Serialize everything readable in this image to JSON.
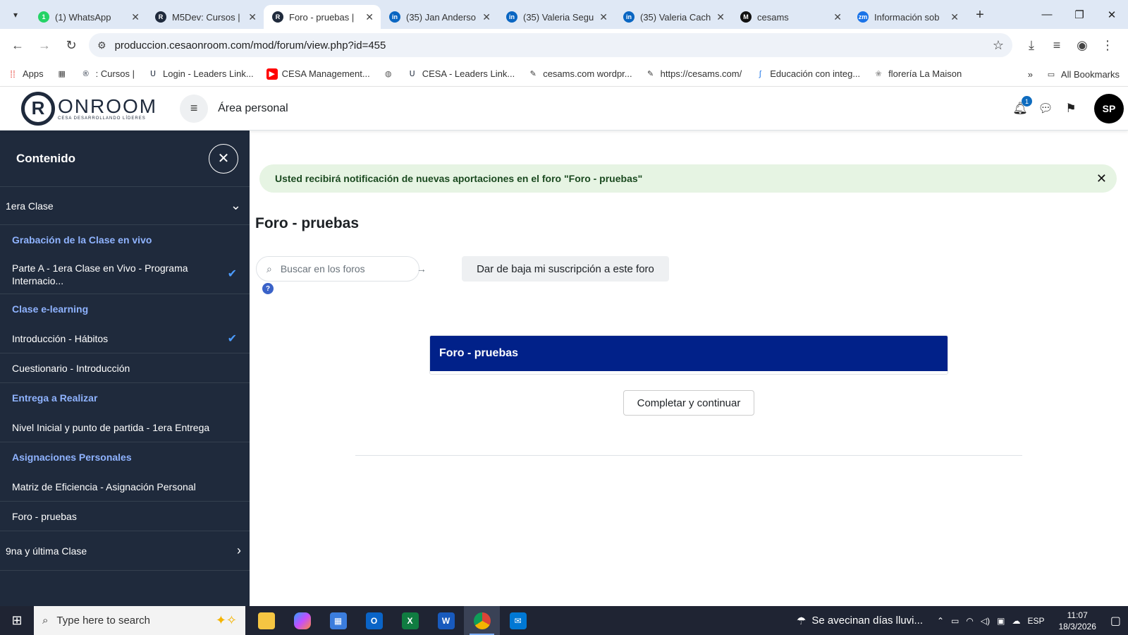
{
  "browser": {
    "tabs": [
      {
        "title": "(1) WhatsApp",
        "icon": "whatsapp-icon",
        "color": "#25d366",
        "glyph": "1"
      },
      {
        "title": "M5Dev: Cursos |",
        "icon": "onroom-icon",
        "color": "#1f2a3c",
        "glyph": "R"
      },
      {
        "title": "Foro - pruebas |",
        "icon": "onroom-icon",
        "color": "#1f2a3c",
        "glyph": "R",
        "active": true
      },
      {
        "title": "(35) Jan Anderso",
        "icon": "linkedin-icon",
        "color": "#0a66c2",
        "glyph": "in"
      },
      {
        "title": "(35) Valeria Segu",
        "icon": "linkedin-icon",
        "color": "#0a66c2",
        "glyph": "in"
      },
      {
        "title": "(35) Valeria Cach",
        "icon": "linkedin-icon",
        "color": "#0a66c2",
        "glyph": "in"
      },
      {
        "title": "cesams",
        "icon": "cesams-icon",
        "color": "#111111",
        "glyph": "M"
      },
      {
        "title": "Información sob",
        "icon": "zm-icon",
        "color": "#1a73e8",
        "glyph": "zm"
      }
    ],
    "url": "produccion.cesaonroom.com/mod/forum/view.php?id=455",
    "bookmarks": [
      {
        "label": "Apps",
        "icon": "apps-grid-icon"
      },
      {
        "label": "",
        "icon": "grid-icon"
      },
      {
        "label": ": Cursos |",
        "icon": "onroom-icon"
      },
      {
        "label": "Login - Leaders Link...",
        "icon": "leaders-link-icon"
      },
      {
        "label": "CESA Management...",
        "icon": "youtube-icon"
      },
      {
        "label": "",
        "icon": "globe-icon"
      },
      {
        "label": "CESA - Leaders Link...",
        "icon": "leaders-link-icon"
      },
      {
        "label": "cesams.com wordpr...",
        "icon": "wordpress-icon"
      },
      {
        "label": "https://cesams.com/",
        "icon": "wordpress-icon"
      },
      {
        "label": "Educación con integ...",
        "icon": "bookmark-icon"
      },
      {
        "label": "florería La Maison",
        "icon": "flower-icon"
      }
    ],
    "all_bookmarks": "All Bookmarks"
  },
  "header": {
    "logo_text": "ONROOM",
    "logo_sub": "CESA DESARROLLANDO LÍDERES",
    "area": "Área personal",
    "notif_count": "1",
    "avatar": "SP"
  },
  "drawer": {
    "title": "Contenido",
    "section1": "1era Clase",
    "items": [
      {
        "label": "Grabación de la Clase en vivo",
        "kind": "head"
      },
      {
        "label": "Parte A - 1era Clase en Vivo - Programa Internacio...",
        "kind": "tall",
        "done": true
      },
      {
        "label": "Clase e-learning",
        "kind": "head"
      },
      {
        "label": "Introducción - Hábitos",
        "kind": "act",
        "done": true
      },
      {
        "label": "Cuestionario - Introducción",
        "kind": "act"
      },
      {
        "label": "Entrega a Realizar",
        "kind": "head"
      },
      {
        "label": "Nivel Inicial y punto de partida - 1era Entrega",
        "kind": "act"
      },
      {
        "label": "Asignaciones Personales",
        "kind": "head"
      },
      {
        "label": "Matriz de Eficiencia - Asignación Personal",
        "kind": "act"
      },
      {
        "label": "Foro - pruebas",
        "kind": "act"
      }
    ],
    "section2": "9na y última Clase"
  },
  "main": {
    "alert": "Usted recibirá notificación de nuevas aportaciones en el foro \"Foro - pruebas\"",
    "title": "Foro - pruebas",
    "search_placeholder": "Buscar en los foros",
    "unsubscribe": "Dar de baja mi suscripción a este foro",
    "card_title": "Foro - pruebas",
    "complete_button": "Completar y continuar"
  },
  "taskbar": {
    "search_placeholder": "Type here to search",
    "weather": "Se avecinan días lluvi...",
    "lang": "ESP",
    "time": "11:07",
    "date": "18/3/2026"
  }
}
